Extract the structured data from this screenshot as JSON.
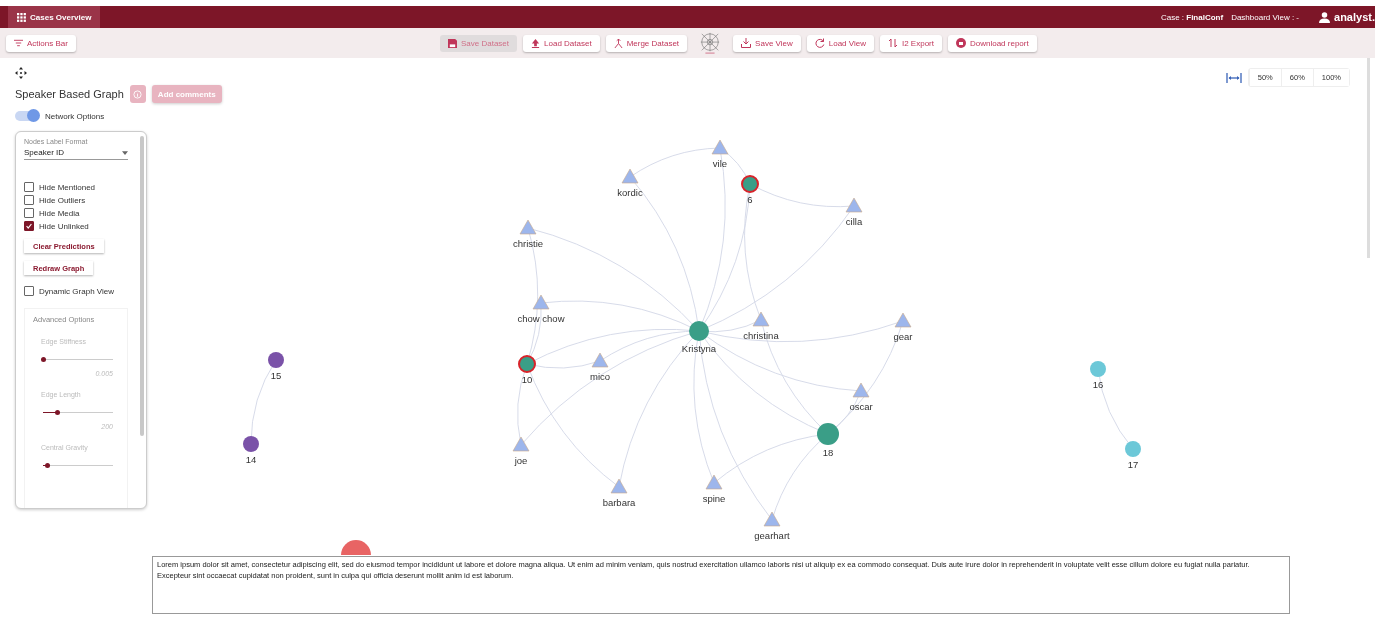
{
  "top_bar": {
    "menu_button": "Cases Overview",
    "case": "Case : **FinalConf**",
    "dashboard_view": "Dashboard View : -",
    "user": "analyst."
  },
  "actions_bar": {
    "toggle": "Actions Bar",
    "buttons": [
      {
        "label": "Save Dataset",
        "disabled": true
      },
      {
        "label": "Load Dataset",
        "disabled": false
      },
      {
        "label": "Merge Dataset",
        "disabled": false
      },
      {
        "label": "Save View",
        "disabled": false
      },
      {
        "label": "Load View",
        "disabled": false
      },
      {
        "label": "I2 Export",
        "disabled": false
      },
      {
        "label": "Download report",
        "disabled": false
      }
    ]
  },
  "graph": {
    "title": "Speaker Based Graph",
    "comment_button": "Add comments",
    "network_options": {
      "label": "Network Options",
      "on": true
    },
    "zoom_options": [
      "50%",
      "60%",
      "100%"
    ],
    "options_panel": {
      "label_format": {
        "label": "Nodes Label Format",
        "value": "Speaker ID"
      },
      "checkboxes": [
        {
          "label": "Hide Mentioned",
          "checked": false
        },
        {
          "label": "Hide Outliers",
          "checked": false
        },
        {
          "label": "Hide Media",
          "checked": false
        },
        {
          "label": "Hide Unlinked",
          "checked": true
        }
      ],
      "buttons": [
        "Clear Predictions",
        "Redraw Graph"
      ],
      "dynamic_view": {
        "label": "Dynamic Graph View",
        "checked": false
      },
      "advanced": {
        "title": "Advanced Options",
        "sliders": [
          {
            "label": "Edge Stiffness",
            "level": 0.0,
            "reading": "0.005"
          },
          {
            "label": "Edge Length",
            "level": 0.2,
            "reading": "200"
          },
          {
            "label": "Central Gravity",
            "level": 0.05
          }
        ]
      }
    },
    "nodes": [
      {
        "label": "Kristyna",
        "kind": "circle",
        "color": "#3a9e87",
        "flagged": false
      },
      {
        "label": "vile",
        "kind": "triangle"
      },
      {
        "label": "6",
        "kind": "circle",
        "color": "#3a9e87",
        "flagged": true
      },
      {
        "label": "kordic",
        "kind": "triangle"
      },
      {
        "label": "cilla",
        "kind": "triangle"
      },
      {
        "label": "christie",
        "kind": "triangle"
      },
      {
        "label": "chow chow",
        "kind": "triangle"
      },
      {
        "label": "christina",
        "kind": "triangle"
      },
      {
        "label": "gear",
        "kind": "triangle"
      },
      {
        "label": "10",
        "kind": "circle",
        "color": "#3a9e87",
        "flagged": true
      },
      {
        "label": "mico",
        "kind": "triangle"
      },
      {
        "label": "oscar",
        "kind": "triangle"
      },
      {
        "label": "18",
        "kind": "circle",
        "color": "#3a9e87",
        "flagged": false
      },
      {
        "label": "joe",
        "kind": "triangle"
      },
      {
        "label": "barbara",
        "kind": "triangle"
      },
      {
        "label": "spine",
        "kind": "triangle"
      },
      {
        "label": "gearhart",
        "kind": "triangle"
      },
      {
        "label": "15",
        "kind": "circle",
        "color": "#7a52a8",
        "flagged": false
      },
      {
        "label": "14",
        "kind": "circle",
        "color": "#7a52a8",
        "flagged": false
      },
      {
        "label": "16",
        "kind": "circle",
        "color": "#6cc8d8",
        "flagged": false
      },
      {
        "label": "17",
        "kind": "circle",
        "color": "#6cc8d8",
        "flagged": false
      },
      {
        "kind": "circle",
        "color": "#e86464",
        "flagged": false
      }
    ],
    "comment_text": "Lorem ipsum dolor sit amet, consectetur adipiscing elit, sed do eiusmod tempor incididunt ut labore et dolore magna aliqua. Ut enim ad minim veniam, quis nostrud exercitation ullamco laboris nisi ut aliquip ex ea commodo consequat. Duis aute irure dolor in reprehenderit in voluptate velit esse cillum dolore eu fugiat nulla pariatur. Excepteur sint occaecat cupidatat non proident, sunt in culpa qui officia deserunt mollit anim id est laborum."
  }
}
